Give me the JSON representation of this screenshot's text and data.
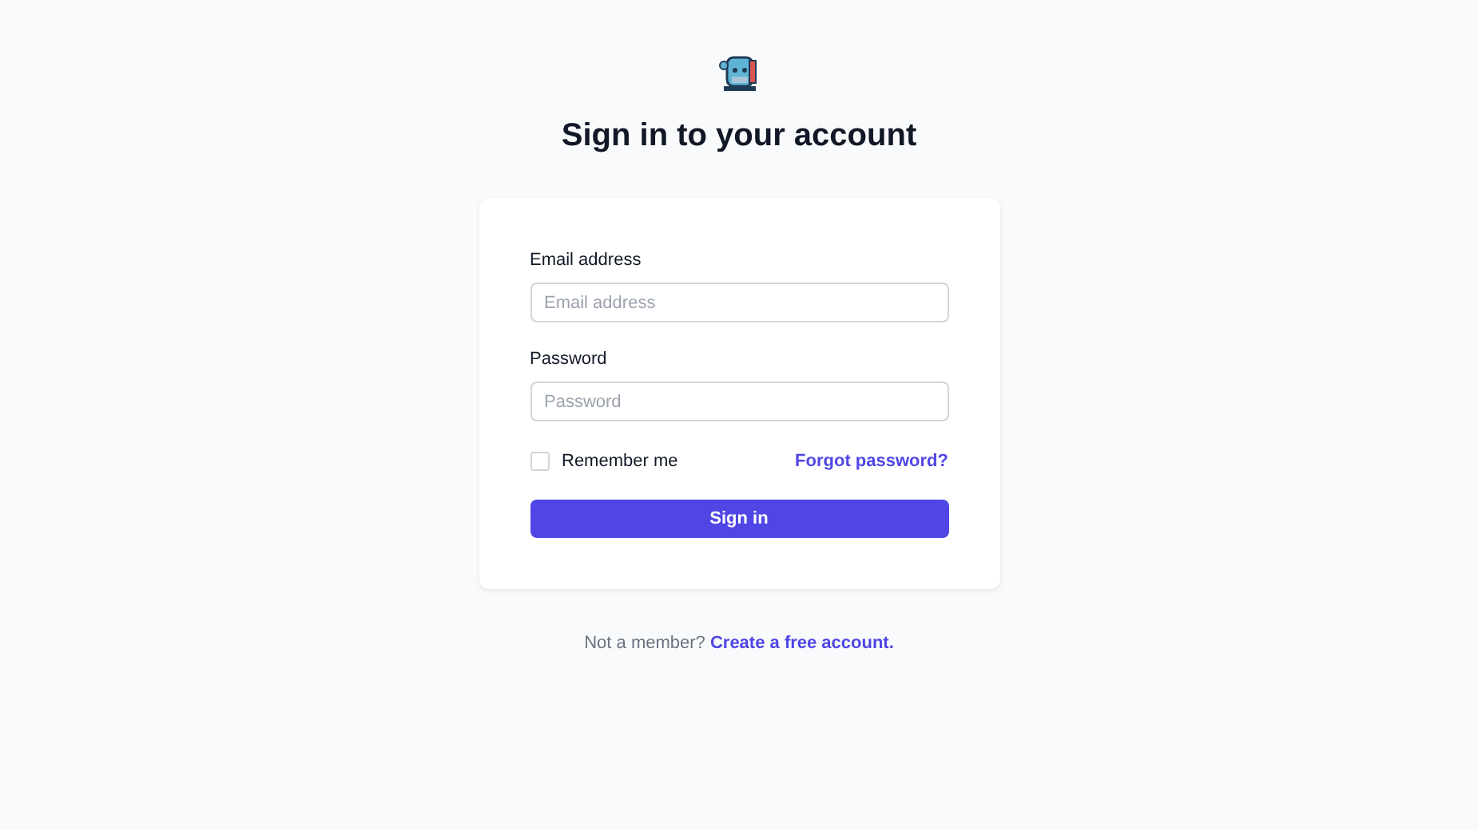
{
  "title": "Sign in to your account",
  "fields": [
    {
      "label": "Email address",
      "placeholder": "Email address"
    },
    {
      "label": "Password",
      "placeholder": "Password"
    }
  ],
  "remember": {
    "label": "Remember me",
    "checked": false
  },
  "forgot_link": "Forgot password?",
  "submit": "Sign in",
  "footer": {
    "text": "Not a member?",
    "link": "Create a free account."
  }
}
